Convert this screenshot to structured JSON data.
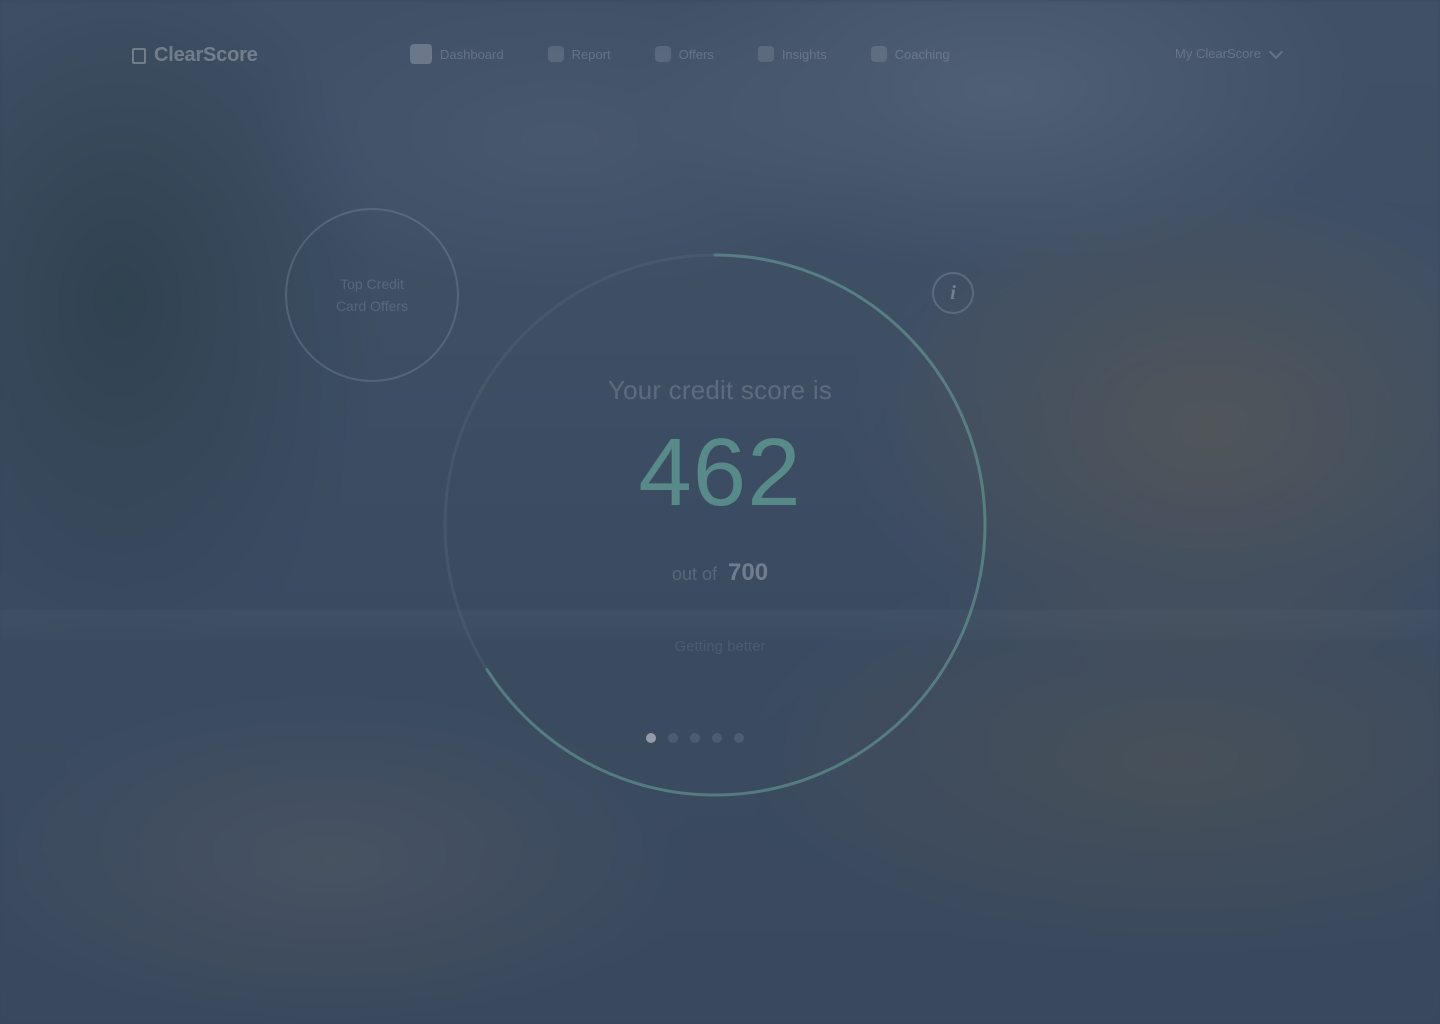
{
  "brand": {
    "name": "ClearScore"
  },
  "nav": {
    "items": [
      {
        "label": "Dashboard",
        "icon": "home-icon",
        "active": true
      },
      {
        "label": "Report",
        "icon": "report-icon",
        "active": false
      },
      {
        "label": "Offers",
        "icon": "offers-icon",
        "active": false
      },
      {
        "label": "Insights",
        "icon": "insights-icon",
        "active": false
      },
      {
        "label": "Coaching",
        "icon": "coaching-icon",
        "active": false
      }
    ],
    "account_label": "My ClearScore"
  },
  "offers_circle": {
    "line1": "Top Credit",
    "line2": "Card Offers"
  },
  "score": {
    "label": "Your credit score is",
    "value": "462",
    "out_of_prefix": "out of",
    "out_of_max": "700",
    "subtext": "Getting better",
    "progress_fraction": 0.66,
    "carousel_count": 5,
    "carousel_active_index": 0
  },
  "colors": {
    "score_accent": "#6ebeaa",
    "overlay": "#34465c"
  },
  "icons": {
    "info": "info-icon"
  }
}
